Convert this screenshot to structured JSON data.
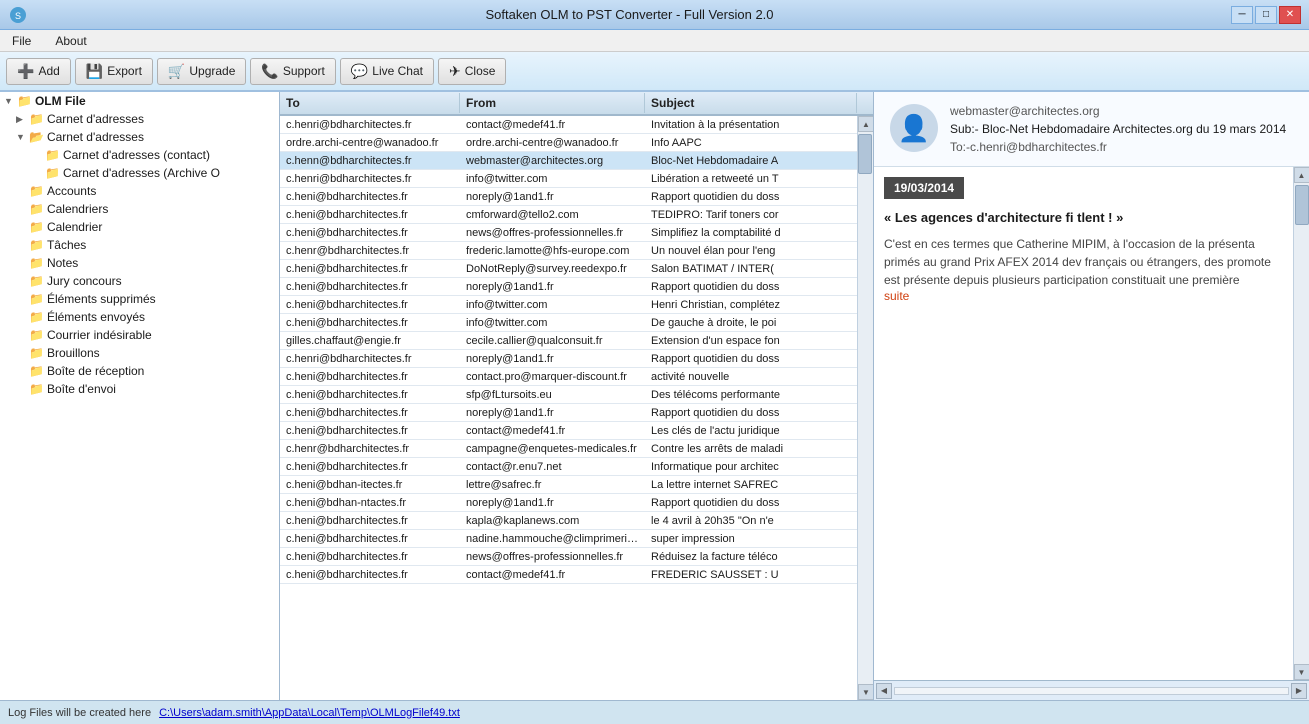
{
  "window": {
    "title": "Softaken OLM to PST Converter - Full Version 2.0",
    "minimize": "─",
    "restore": "□",
    "close": "✕"
  },
  "menu": {
    "file": "File",
    "about": "About"
  },
  "toolbar": {
    "add": "Add",
    "export": "Export",
    "upgrade": "Upgrade",
    "support": "Support",
    "live_chat": "Live Chat",
    "close": "Close"
  },
  "tree": {
    "root": "OLM File",
    "items": [
      {
        "label": "Carnet d'adresses",
        "level": 1,
        "type": "folder"
      },
      {
        "label": "Carnet d'adresses",
        "level": 1,
        "type": "folder-open"
      },
      {
        "label": "Carnet d'adresses  (contact)",
        "level": 2,
        "type": "folder"
      },
      {
        "label": "Carnet d'adresses  (Archive O",
        "level": 2,
        "type": "folder"
      },
      {
        "label": "Accounts",
        "level": 1,
        "type": "folder"
      },
      {
        "label": "Calendriers",
        "level": 1,
        "type": "folder"
      },
      {
        "label": "Calendrier",
        "level": 1,
        "type": "folder"
      },
      {
        "label": "Tâches",
        "level": 1,
        "type": "folder"
      },
      {
        "label": "Notes",
        "level": 1,
        "type": "folder"
      },
      {
        "label": "Jury concours",
        "level": 1,
        "type": "folder"
      },
      {
        "label": "Éléments supprimés",
        "level": 1,
        "type": "folder"
      },
      {
        "label": "Éléments envoyés",
        "level": 1,
        "type": "folder"
      },
      {
        "label": "Courrier indésirable",
        "level": 1,
        "type": "folder"
      },
      {
        "label": "Brouillons",
        "level": 1,
        "type": "folder"
      },
      {
        "label": "Boîte de réception",
        "level": 1,
        "type": "folder"
      },
      {
        "label": "Boîte d'envoi",
        "level": 1,
        "type": "folder"
      }
    ]
  },
  "email_table": {
    "headers": {
      "to": "To",
      "from": "From",
      "subject": "Subject"
    },
    "rows": [
      {
        "to": "c.henri@bdharchitectes.fr",
        "from": "contact@medef41.fr",
        "subject": "Invitation à la présentation"
      },
      {
        "to": "ordre.archi-centre@wanadoo.fr",
        "from": "ordre.archi-centre@wanadoo.fr",
        "subject": "Info AAPC"
      },
      {
        "to": "c.henn@bdharchitectes.fr",
        "from": "webmaster@architectes.org",
        "subject": "Bloc-Net Hebdomadaire A"
      },
      {
        "to": "c.henri@bdharchitectes.fr",
        "from": "info@twitter.com",
        "subject": "Libération a retweeté un T"
      },
      {
        "to": "c.heni@bdharchitectes.fr",
        "from": "noreply@1and1.fr",
        "subject": "Rapport quotidien du doss"
      },
      {
        "to": "c.heni@bdharchitectes.fr",
        "from": "cmforward@tello2.com",
        "subject": "TEDIPRO: Tarif toners cor"
      },
      {
        "to": "c.heni@bdharchitectes.fr",
        "from": "news@offres-professionnelles.fr",
        "subject": "Simplifiez la comptabilité d"
      },
      {
        "to": "c.henr@bdharchitectes.fr",
        "from": "frederic.lamotte@hfs-europe.com",
        "subject": "Un nouvel élan pour l'eng"
      },
      {
        "to": "c.heni@bdharchitectes.fr",
        "from": "DoNotReply@survey.reedexpo.fr",
        "subject": "Salon BATIMAT / INTER("
      },
      {
        "to": "c.heni@bdharchitectes.fr",
        "from": "noreply@1and1.fr",
        "subject": "Rapport quotidien du doss"
      },
      {
        "to": "c.heni@bdharchitectes.fr",
        "from": "info@twitter.com",
        "subject": "Henri Christian, complétez"
      },
      {
        "to": "c.heni@bdharchitectes.fr",
        "from": "info@twitter.com",
        "subject": "De gauche à droite, le poi"
      },
      {
        "to": "gilles.chaffaut@engie.fr",
        "from": "cecile.callier@qualconsuit.fr",
        "subject": "Extension d'un espace fon"
      },
      {
        "to": "c.henri@bdharchitectes.fr",
        "from": "noreply@1and1.fr",
        "subject": "Rapport quotidien du doss"
      },
      {
        "to": "c.heni@bdharchitectes.fr",
        "from": "contact.pro@marquer-discount.fr",
        "subject": "activité nouvelle"
      },
      {
        "to": "c.heni@bdharchitectes.fr",
        "from": "sfp@fLtursoits.eu",
        "subject": "Des télécoms performante"
      },
      {
        "to": "c.heni@bdharchitectes.fr",
        "from": "noreply@1and1.fr",
        "subject": "Rapport quotidien du doss"
      },
      {
        "to": "c.heni@bdharchitectes.fr",
        "from": "contact@medef41.fr",
        "subject": "Les clés de l'actu juridique"
      },
      {
        "to": "c.henr@bdharchitectes.fr",
        "from": "campagne@enquetes-medicales.fr",
        "subject": "Contre les arrêts de maladi"
      },
      {
        "to": "c.heni@bdharchitectes.fr",
        "from": "contact@r.enu7.net",
        "subject": "Informatique pour architec"
      },
      {
        "to": "c.heni@bdhan-itectes.fr",
        "from": "lettre@safrec.fr",
        "subject": "La lettre internet SAFREC"
      },
      {
        "to": "c.heni@bdhan-ntactes.fr",
        "from": "noreply@1and1.fr",
        "subject": "Rapport quotidien du doss"
      },
      {
        "to": "c.heni@bdharchitectes.fr",
        "from": "kapla@kaplanews.com",
        "subject": "le 4 avril à 20h35  \"On n'e"
      },
      {
        "to": "c.heni@bdharchitectes.fr",
        "from": "nadine.hammouche@climprimerie.co",
        "subject": "super  impression"
      },
      {
        "to": "c.heni@bdharchitectes.fr",
        "from": "news@offres-professionnelles.fr",
        "subject": "Réduisez la facture téléco"
      },
      {
        "to": "c.heni@bdharchitectes.fr",
        "from": "contact@medef41.fr",
        "subject": "FREDERIC SAUSSET : U"
      }
    ]
  },
  "preview": {
    "from": "webmaster@architectes.org",
    "subject": "Sub:- Bloc-Net Hebdomadaire Architectes.org du 19 mars 2014",
    "to": "To:-c.henri@bdharchitectes.fr",
    "date_badge": "19/03/2014",
    "article_title": "« Les agences d'architecture fi\ntlent ! »",
    "article_body": "C'est en ces termes que Catherine\nMIPIM, à l'occasion de la présenta\nprimés au grand Prix AFEX 2014 dev\nfrançais ou étrangers, des promote\nest présente depuis plusieurs\nparticipation constituait une première",
    "suite": "suite"
  },
  "status_bar": {
    "log_label": "Log Files will be created here",
    "log_path": "C:\\Users\\adam.smith\\AppData\\Local\\Temp\\OLMLogFilef49.txt"
  }
}
